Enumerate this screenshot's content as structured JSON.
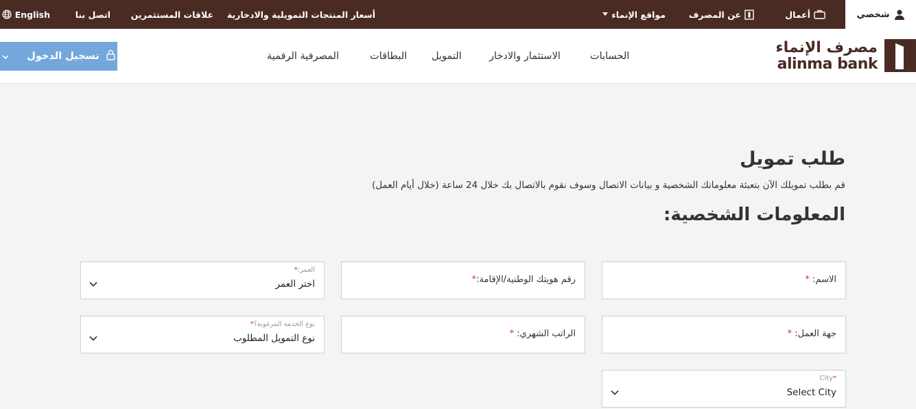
{
  "topbar": {
    "personal": "شخصي",
    "business": "أعمال",
    "about": "عن المصرف",
    "branches": "مواقع الإنماء",
    "prices": "أسعار المنتجات التمويلية والادخارية",
    "investors": "علاقات المستثمرين",
    "contact": "اتصل بنا",
    "language": "English"
  },
  "logo": {
    "arabic": "مصرف الإنماء",
    "english": "alinma bank"
  },
  "nav": {
    "accounts": "الحسابات",
    "invest": "الاستثمار والادخار",
    "finance": "التمويل",
    "cards": "البطاقات",
    "digital": "المصرفية الرقمية"
  },
  "login": {
    "label": "تسجيل الدخول"
  },
  "page": {
    "title": "طلب تمويل",
    "subtitle": "قم بطلب تمويلك الآن بتعبئة معلوماتك الشخصية و بيانات الاتصال وسوف نقوم بالاتصال بك خلال 24 ساعة (خلال أيام العمل)",
    "section": "المعلومات الشخصية:"
  },
  "form": {
    "name": {
      "label": "الاسم:",
      "req": "*"
    },
    "national_id": {
      "label": "رقم هويتك الوطنية/الإقامة:",
      "req": "*"
    },
    "age": {
      "small": "العمر:",
      "req": "*",
      "value": "اختر العمر"
    },
    "employer": {
      "label": "جهة العمل:",
      "req": "*"
    },
    "salary": {
      "label": "الراتب الشهري:",
      "req": "*"
    },
    "service": {
      "small": "نوع الخدمة المرغوبة؟",
      "req": "*",
      "value": "نوع التمويل المطلوب"
    },
    "city": {
      "small": "City",
      "req": "*",
      "value": "Select City"
    }
  },
  "colors": {
    "brand": "#4a2b24",
    "login": "#74a7dc",
    "required": "#d9302a"
  }
}
